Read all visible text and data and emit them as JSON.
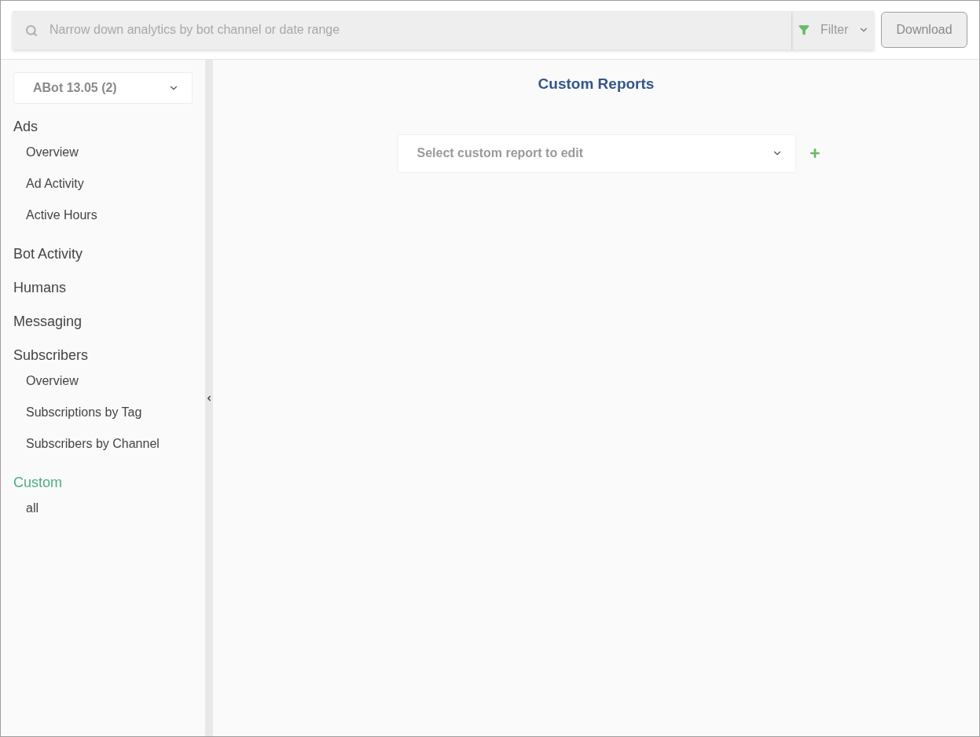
{
  "search": {
    "placeholder": "Narrow down analytics by bot channel or date range"
  },
  "filter": {
    "label": "Filter"
  },
  "download_button": "Download",
  "sidebar": {
    "bot_select": "ABot 13.05 (2)",
    "groups": [
      {
        "label": "Ads",
        "selected": false,
        "children": [
          {
            "label": "Overview"
          },
          {
            "label": "Ad Activity"
          },
          {
            "label": "Active Hours"
          }
        ]
      },
      {
        "label": "Bot Activity",
        "selected": false
      },
      {
        "label": "Humans",
        "selected": false
      },
      {
        "label": "Messaging",
        "selected": false
      },
      {
        "label": "Subscribers",
        "selected": false,
        "children": [
          {
            "label": "Overview"
          },
          {
            "label": "Subscriptions by Tag"
          },
          {
            "label": "Subscribers by Channel"
          }
        ]
      },
      {
        "label": "Custom",
        "selected": true,
        "children": [
          {
            "label": "all"
          }
        ]
      }
    ]
  },
  "main": {
    "title": "Custom Reports",
    "report_select": {
      "placeholder": "Select custom report to edit"
    }
  }
}
